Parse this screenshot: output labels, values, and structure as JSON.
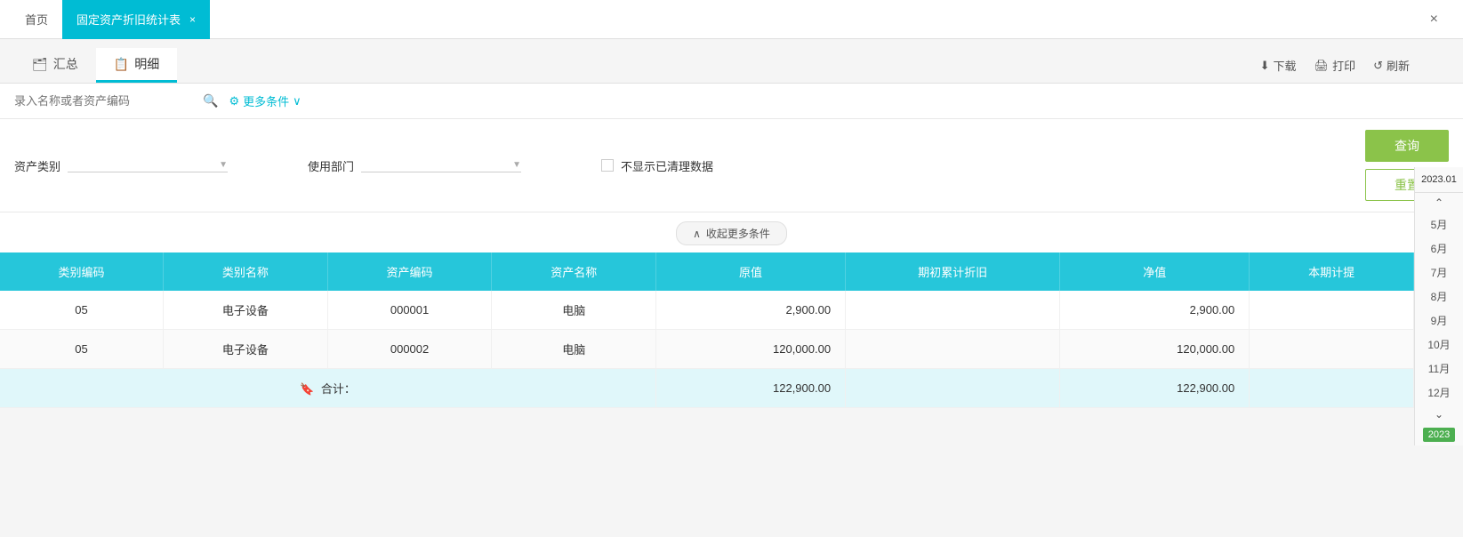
{
  "nav": {
    "home_label": "首页",
    "tab_label": "固定资产折旧统计表",
    "close_icon": "×",
    "window_close": "×"
  },
  "subtabs": [
    {
      "id": "summary",
      "label": "汇总",
      "icon": "🗂",
      "active": false
    },
    {
      "id": "detail",
      "label": "明细",
      "icon": "📋",
      "active": true
    }
  ],
  "toolbar": {
    "download_label": "下载",
    "print_label": "打印",
    "refresh_label": "刷新",
    "download_icon": "⬇",
    "print_icon": "🖨",
    "refresh_icon": "↺"
  },
  "search": {
    "placeholder": "录入名称或者资产编码",
    "more_filters_label": "更多条件"
  },
  "filters": {
    "asset_type_label": "资产类别",
    "department_label": "使用部门",
    "hide_cleared_label": "不显示已清理数据",
    "query_label": "查询",
    "reset_label": "重置"
  },
  "collapse": {
    "label": "收起更多条件"
  },
  "date_panel": {
    "header": "2023.01",
    "up_nav": "⌃",
    "down_nav": "⌄",
    "months": [
      "5月",
      "6月",
      "7月",
      "8月",
      "9月",
      "10月",
      "11月",
      "12月"
    ],
    "year_badge": "2023"
  },
  "table": {
    "headers": [
      "类别编码",
      "类别名称",
      "资产编码",
      "资产名称",
      "原值",
      "期初累计折旧",
      "净值",
      "本期计提"
    ],
    "rows": [
      {
        "cat_code": "05",
        "cat_name": "电子设备",
        "asset_code": "000001",
        "asset_name": "电脑",
        "original": "2,900.00",
        "accum_depr": "",
        "net_value": "2,900.00",
        "period_depr": ""
      },
      {
        "cat_code": "05",
        "cat_name": "电子设备",
        "asset_code": "000002",
        "asset_name": "电脑",
        "original": "120,000.00",
        "accum_depr": "",
        "net_value": "120,000.00",
        "period_depr": ""
      }
    ],
    "total": {
      "label": "合计：",
      "original": "122,900.00",
      "accum_depr": "",
      "net_value": "122,900.00",
      "period_depr": ""
    }
  }
}
